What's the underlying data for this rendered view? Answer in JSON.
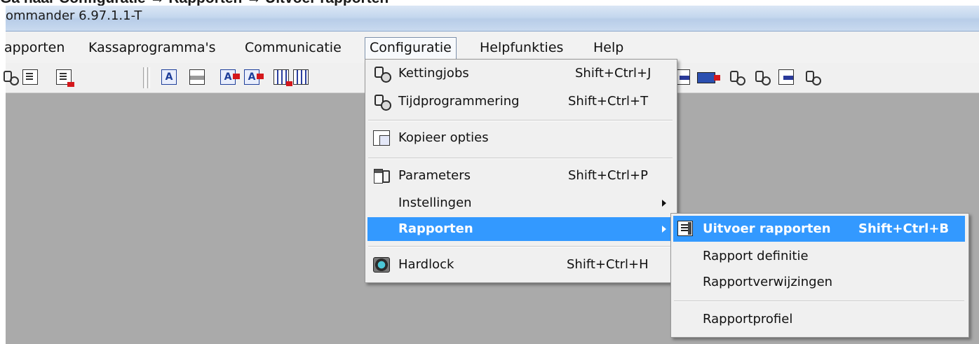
{
  "caption": "Ga naar  Configuratie → Rapporten → Uitvoer rapporten",
  "window": {
    "title": "ommander 6.97.1.1-T"
  },
  "menubar": {
    "items": [
      {
        "label": "apporten"
      },
      {
        "label": "Kassaprogramma's"
      },
      {
        "label": "Communicatie"
      },
      {
        "label": "Configuratie"
      },
      {
        "label": "Helpfunkties"
      },
      {
        "label": "Help"
      }
    ],
    "active": "Configuratie"
  },
  "config_menu": {
    "items": [
      {
        "label": "Kettingjobs",
        "shortcut": "Shift+Ctrl+J",
        "icon": "wrench-icon"
      },
      {
        "label": "Tijdprogrammering",
        "shortcut": "Shift+Ctrl+T",
        "icon": "clock-wrench-icon"
      },
      {
        "label": "Kopieer opties",
        "shortcut": "",
        "icon": "copy-options-icon"
      },
      {
        "label": "Parameters",
        "shortcut": "Shift+Ctrl+P",
        "icon": "parameters-icon"
      },
      {
        "label": "Instellingen",
        "shortcut": "",
        "submenu": true
      },
      {
        "label": "Rapporten",
        "shortcut": "",
        "submenu": true,
        "highlighted": true
      },
      {
        "label": "Hardlock",
        "shortcut": "Shift+Ctrl+H",
        "icon": "hardlock-icon"
      }
    ]
  },
  "rapporten_submenu": {
    "items": [
      {
        "label": "Uitvoer rapporten",
        "shortcut": "Shift+Ctrl+B",
        "icon": "report-icon",
        "highlighted": true
      },
      {
        "label": "Rapport definitie",
        "shortcut": ""
      },
      {
        "label": "Rapportverwijzingen",
        "shortcut": ""
      },
      {
        "label": "Rapportprofiel",
        "shortcut": ""
      }
    ]
  },
  "colors": {
    "highlight": "#3399ff",
    "workspace": "#aaaaaa",
    "menu_bg": "#f0f0f0"
  }
}
